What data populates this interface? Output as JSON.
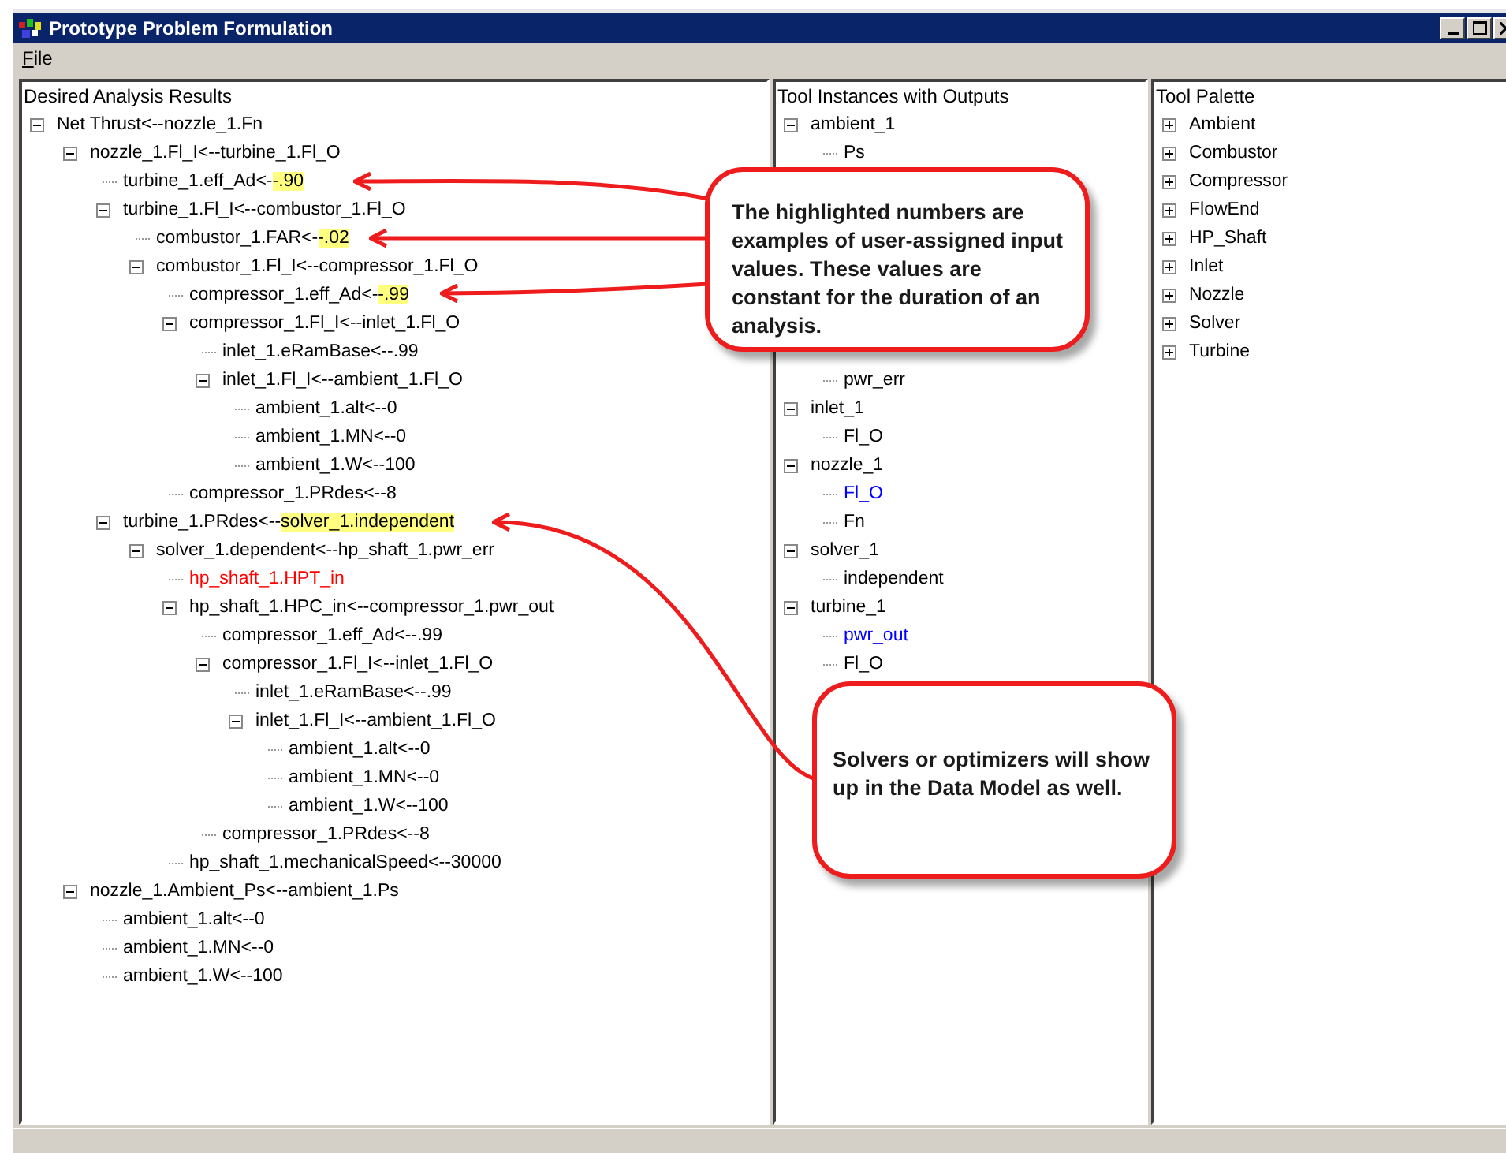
{
  "window": {
    "title": "Prototype Problem Formulation"
  },
  "menu": [
    "File"
  ],
  "desired_results": {
    "title": "Desired Analysis Results",
    "items": [
      {
        "label": "Net Thrust<--nozzle_1.Fn",
        "expanded": true,
        "children": [
          {
            "label": "nozzle_1.Fl_I<--turbine_1.Fl_O",
            "expanded": true,
            "children": [
              {
                "label": "turbine_1.eff_Ad<-",
                "highlight": "-.90"
              },
              {
                "label": "turbine_1.Fl_I<--combustor_1.Fl_O",
                "expanded": true,
                "children": [
                  {
                    "label": "combustor_1.FAR<-",
                    "highlight": "-.02"
                  },
                  {
                    "label": "combustor_1.Fl_I<--compressor_1.Fl_O",
                    "expanded": true,
                    "children": [
                      {
                        "label": "compressor_1.eff_Ad<-",
                        "highlight": "-.99"
                      },
                      {
                        "label": "compressor_1.Fl_I<--inlet_1.Fl_O",
                        "expanded": true,
                        "children": [
                          {
                            "label": "inlet_1.eRamBase<--.99"
                          },
                          {
                            "label": "inlet_1.Fl_I<--ambient_1.Fl_O",
                            "expanded": true,
                            "children": [
                              {
                                "label": "ambient_1.alt<--0"
                              },
                              {
                                "label": "ambient_1.MN<--0"
                              },
                              {
                                "label": "ambient_1.W<--100"
                              }
                            ]
                          }
                        ]
                      },
                      {
                        "label": "compressor_1.PRdes<--8"
                      }
                    ]
                  }
                ]
              },
              {
                "label": "turbine_1.PRdes<--",
                "highlight": "solver_1.independent",
                "expanded": true,
                "children": [
                  {
                    "label": "solver_1.dependent<--hp_shaft_1.pwr_err",
                    "expanded": true,
                    "children": [
                      {
                        "label": "hp_shaft_1.HPT_in",
                        "color": "#ff0000"
                      },
                      {
                        "label": "hp_shaft_1.HPC_in<--compressor_1.pwr_out",
                        "expanded": true,
                        "children": [
                          {
                            "label": "compressor_1.eff_Ad<--.99"
                          },
                          {
                            "label": "compressor_1.Fl_I<--inlet_1.Fl_O",
                            "expanded": true,
                            "children": [
                              {
                                "label": "inlet_1.eRamBase<--.99"
                              },
                              {
                                "label": "inlet_1.Fl_I<--ambient_1.Fl_O",
                                "expanded": true,
                                "children": [
                                  {
                                    "label": "ambient_1.alt<--0"
                                  },
                                  {
                                    "label": "ambient_1.MN<--0"
                                  },
                                  {
                                    "label": "ambient_1.W<--100"
                                  }
                                ]
                              }
                            ]
                          },
                          {
                            "label": "compressor_1.PRdes<--8"
                          }
                        ]
                      },
                      {
                        "label": "hp_shaft_1.mechanicalSpeed<--30000"
                      }
                    ]
                  }
                ]
              }
            ]
          },
          {
            "label": "nozzle_1.Ambient_Ps<--ambient_1.Ps",
            "expanded": true,
            "children": [
              {
                "label": "ambient_1.alt<--0"
              },
              {
                "label": "ambient_1.MN<--0"
              },
              {
                "label": "ambient_1.W<--100"
              }
            ]
          }
        ]
      }
    ]
  },
  "tool_instances": {
    "title": "Tool Instances with Outputs",
    "items_above": [
      {
        "label": "ambient_1",
        "expanded": true,
        "children": [
          {
            "label": "Ps"
          }
        ]
      }
    ],
    "continued_children": [
      {
        "label": "pwr_err"
      }
    ],
    "items_below": [
      {
        "label": "inlet_1",
        "expanded": true,
        "children": [
          {
            "label": "Fl_O"
          }
        ]
      },
      {
        "label": "nozzle_1",
        "expanded": true,
        "children": [
          {
            "label": "Fl_O",
            "color": "#0000ff"
          },
          {
            "label": "Fn"
          }
        ]
      },
      {
        "label": "solver_1",
        "expanded": true,
        "children": [
          {
            "label": "independent"
          }
        ]
      },
      {
        "label": "turbine_1",
        "expanded": true,
        "children": [
          {
            "label": "pwr_out",
            "color": "#0000ff"
          },
          {
            "label": "Fl_O"
          }
        ]
      }
    ]
  },
  "tool_palette": {
    "title": "Tool Palette",
    "items": [
      {
        "label": "Ambient",
        "expanded": false
      },
      {
        "label": "Combustor",
        "expanded": false
      },
      {
        "label": "Compressor",
        "expanded": false
      },
      {
        "label": "FlowEnd",
        "expanded": false
      },
      {
        "label": "HP_Shaft",
        "expanded": false
      },
      {
        "label": "Inlet",
        "expanded": false
      },
      {
        "label": "Nozzle",
        "expanded": false
      },
      {
        "label": "Solver",
        "expanded": false
      },
      {
        "label": "Turbine",
        "expanded": false
      }
    ]
  },
  "callouts": [
    {
      "text": "The highlighted numbers are examples of user-assigned input values.  These values are constant for the duration of an analysis."
    },
    {
      "text": "Solvers or optimizers will show up in the Data Model as well."
    }
  ]
}
